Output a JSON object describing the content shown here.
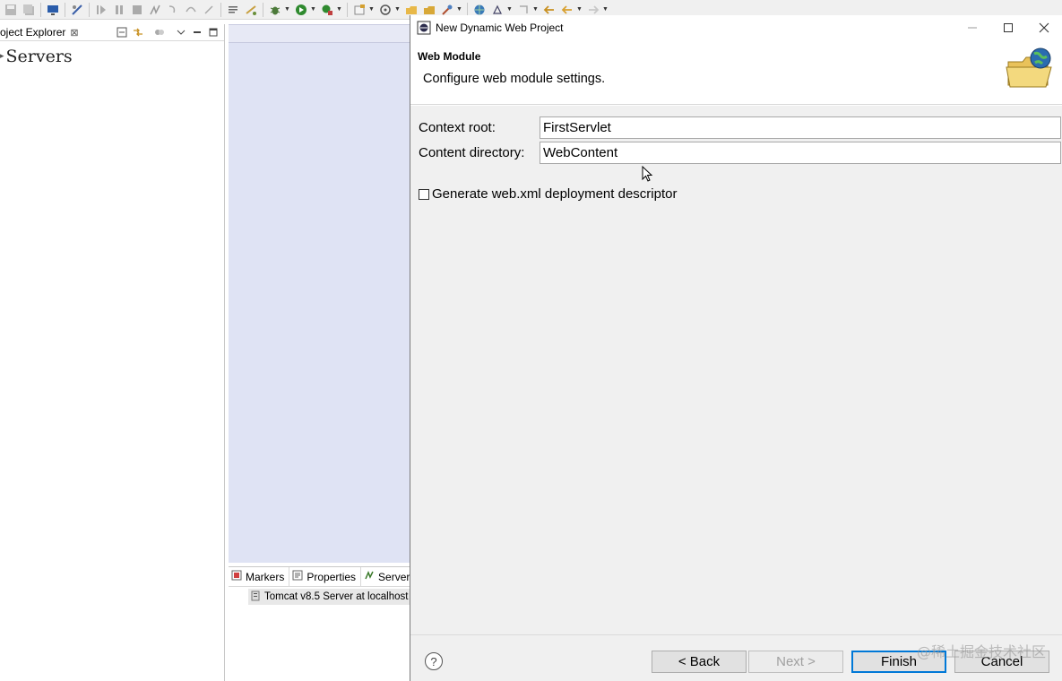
{
  "toolbar": {
    "icons": [
      "save-icon",
      "save-all-icon",
      "monitor-icon",
      "skip-icon",
      "resume-icon",
      "suspend-icon",
      "terminate-icon",
      "disconnect-icon",
      "step-into-icon",
      "step-over-icon",
      "step-return-icon",
      "task-icon",
      "link-icon",
      "debug-icon",
      "run-icon",
      "external-tools-icon",
      "new-icon",
      "new-server-icon",
      "open-type-icon",
      "open-folder-icon",
      "search-icon",
      "globe-icon",
      "annotation-icon",
      "next-annotation-icon",
      "back-icon",
      "forward-icon"
    ]
  },
  "explorer": {
    "tab_label": "oject Explorer",
    "tab_close": "⊠",
    "tree": {
      "servers_label": "Servers"
    }
  },
  "bottom_panel": {
    "tabs": [
      {
        "label": "Markers"
      },
      {
        "label": "Properties"
      },
      {
        "label": "Servers"
      }
    ],
    "server_entry": "Tomcat v8.5 Server at localhost"
  },
  "dialog": {
    "title": "New Dynamic Web Project",
    "header_title": "Web Module",
    "header_description": "Configure web module settings.",
    "context_root_label": "Context root:",
    "context_root_value": "FirstServlet",
    "content_directory_label": "Content directory:",
    "content_directory_value": "WebContent",
    "generate_label": "Generate web.xml deployment descriptor",
    "generate_checked": false,
    "help_symbol": "?",
    "buttons": {
      "back": "< Back",
      "next": "Next >",
      "finish": "Finish",
      "cancel": "Cancel"
    }
  },
  "watermark": "@稀土掘金技术社区",
  "colors": {
    "editor_bg": "#dfe3f4",
    "dialog_content_bg": "#f0f0f0",
    "default_button_border": "#0078d7"
  }
}
